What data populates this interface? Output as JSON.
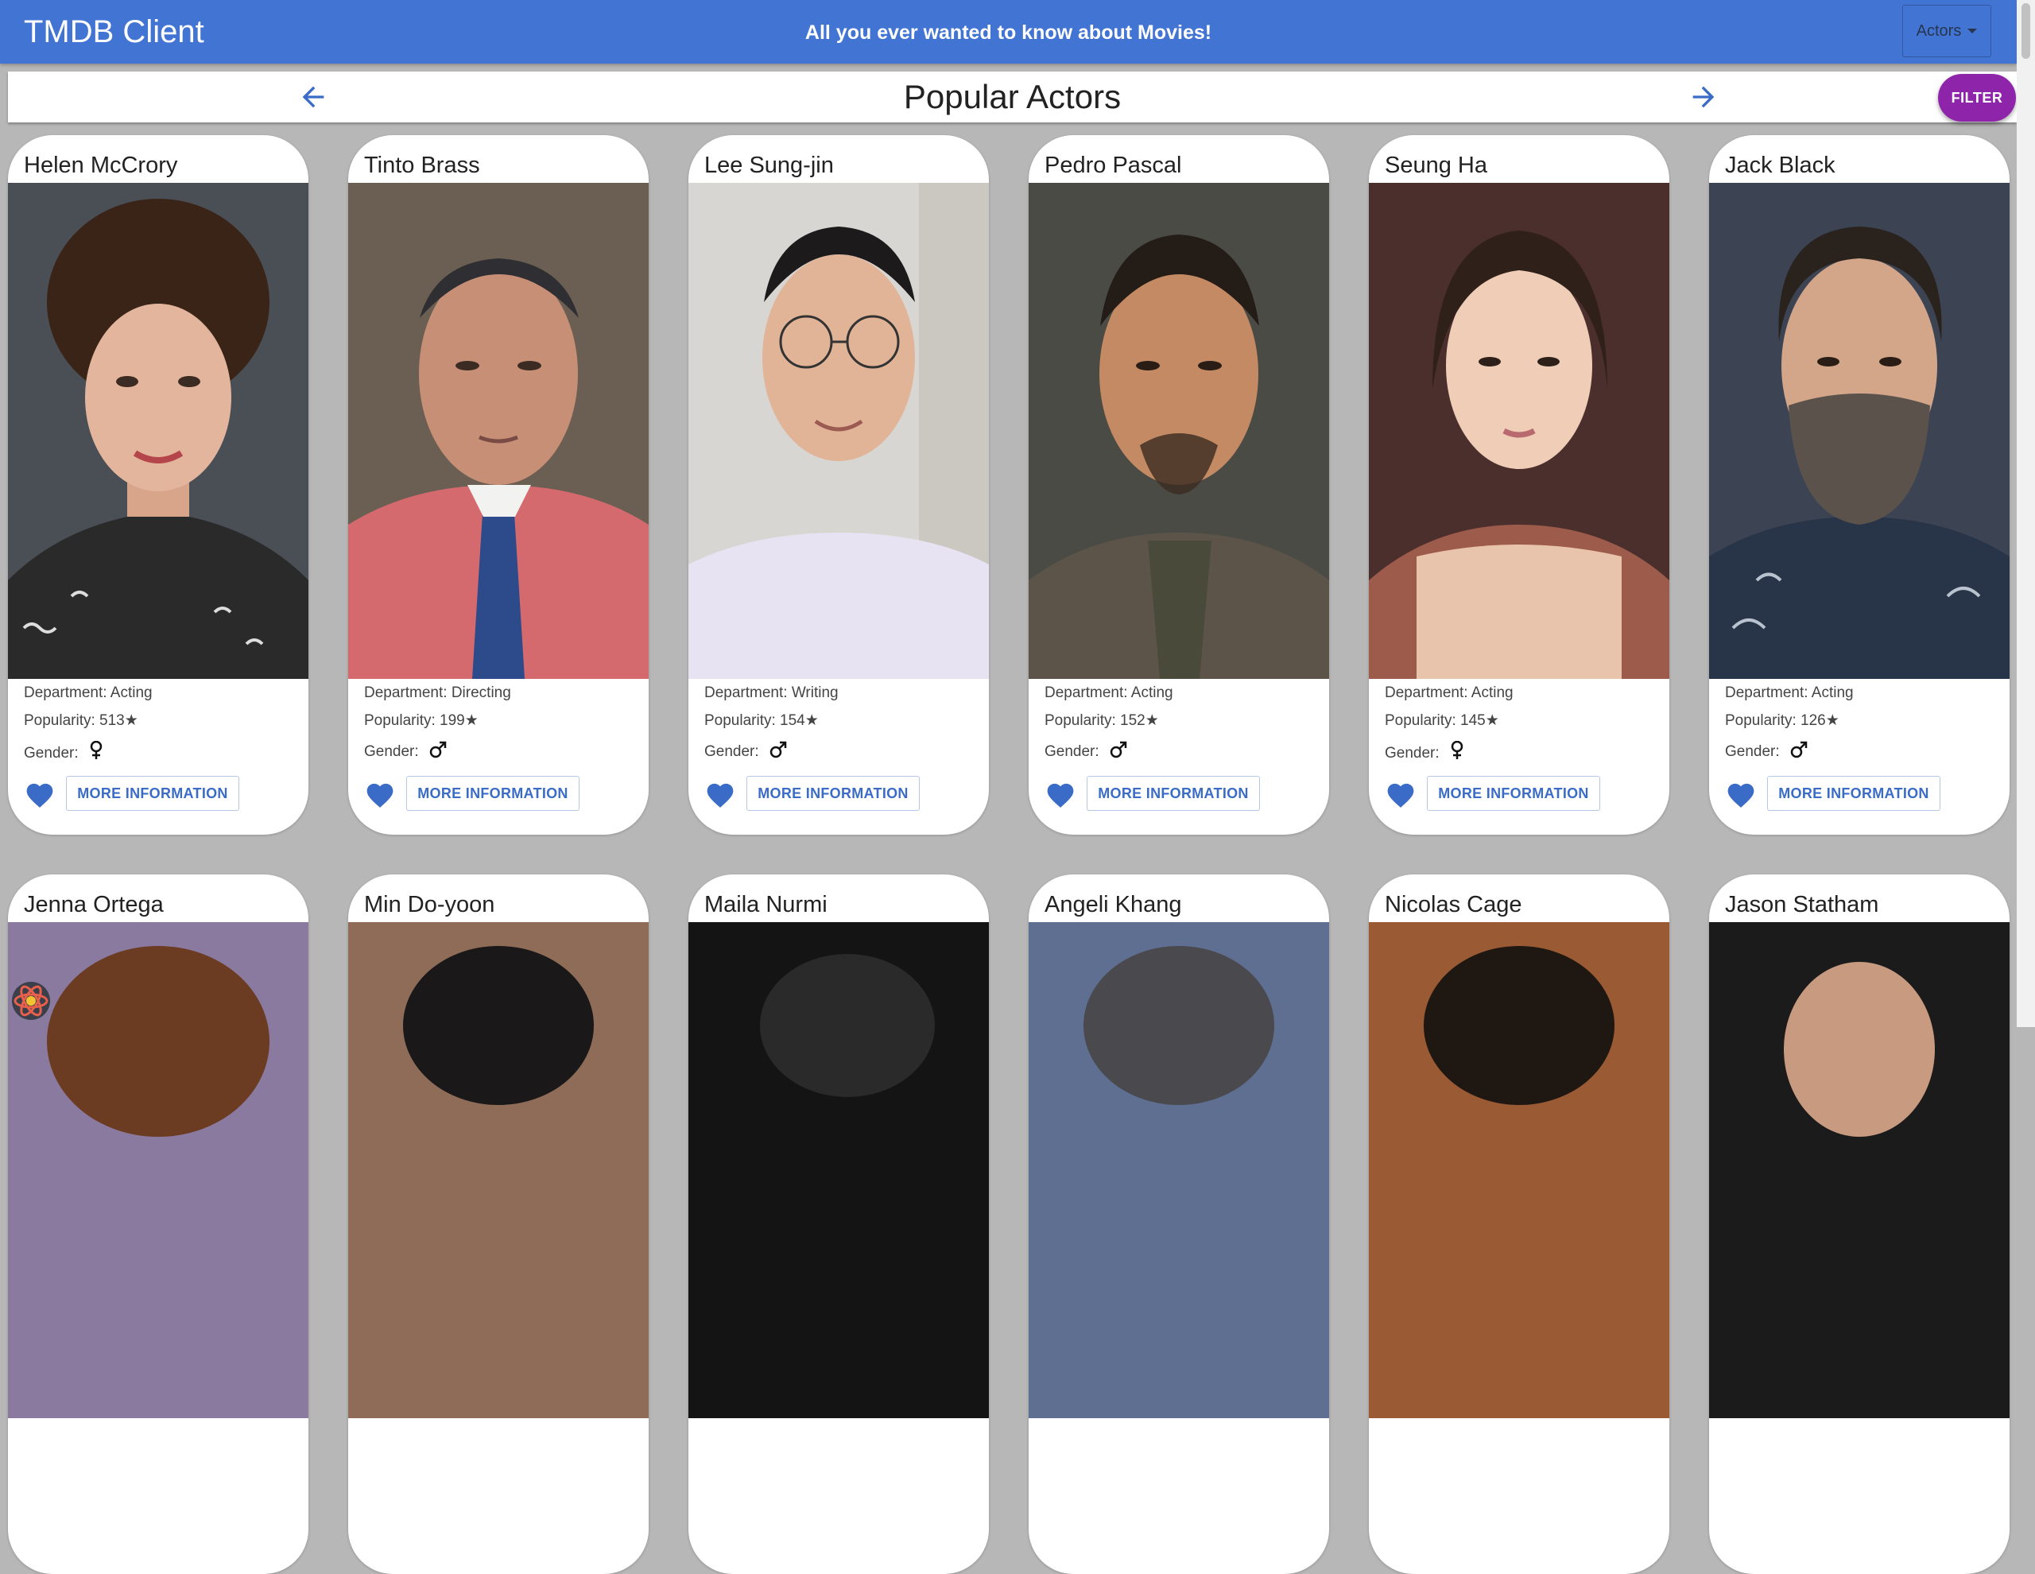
{
  "app": {
    "title": "TMDB Client",
    "tagline": "All you ever wanted to know about Movies!",
    "category_select": "Actors"
  },
  "page": {
    "title": "Popular Actors",
    "filter_label": "FILTER"
  },
  "colors": {
    "appbar": "#4274d3",
    "accent": "#3a6cc7",
    "filter": "#8e24aa",
    "background": "#b7b7b7"
  },
  "actors": [
    {
      "name": "Helen McCrory",
      "department": "Department: Acting",
      "popularity": "Popularity: 513★",
      "gender_label": "Gender:",
      "gender_icon": "female-icon",
      "button": "MORE INFORMATION"
    },
    {
      "name": "Tinto Brass",
      "department": "Department: Directing",
      "popularity": "Popularity: 199★",
      "gender_label": "Gender:",
      "gender_icon": "male-icon",
      "button": "MORE INFORMATION"
    },
    {
      "name": "Lee Sung-jin",
      "department": "Department: Writing",
      "popularity": "Popularity: 154★",
      "gender_label": "Gender:",
      "gender_icon": "male-icon",
      "button": "MORE INFORMATION"
    },
    {
      "name": "Pedro Pascal",
      "department": "Department: Acting",
      "popularity": "Popularity: 152★",
      "gender_label": "Gender:",
      "gender_icon": "male-icon",
      "button": "MORE INFORMATION"
    },
    {
      "name": "Seung Ha",
      "department": "Department: Acting",
      "popularity": "Popularity: 145★",
      "gender_label": "Gender:",
      "gender_icon": "female-icon",
      "button": "MORE INFORMATION"
    },
    {
      "name": "Jack Black",
      "department": "Department: Acting",
      "popularity": "Popularity: 126★",
      "gender_label": "Gender:",
      "gender_icon": "male-icon",
      "button": "MORE INFORMATION"
    },
    {
      "name": "Jenna Ortega"
    },
    {
      "name": "Min Do-yoon"
    },
    {
      "name": "Maila Nurmi"
    },
    {
      "name": "Angeli Khang"
    },
    {
      "name": "Nicolas Cage"
    },
    {
      "name": "Jason Statham"
    }
  ]
}
